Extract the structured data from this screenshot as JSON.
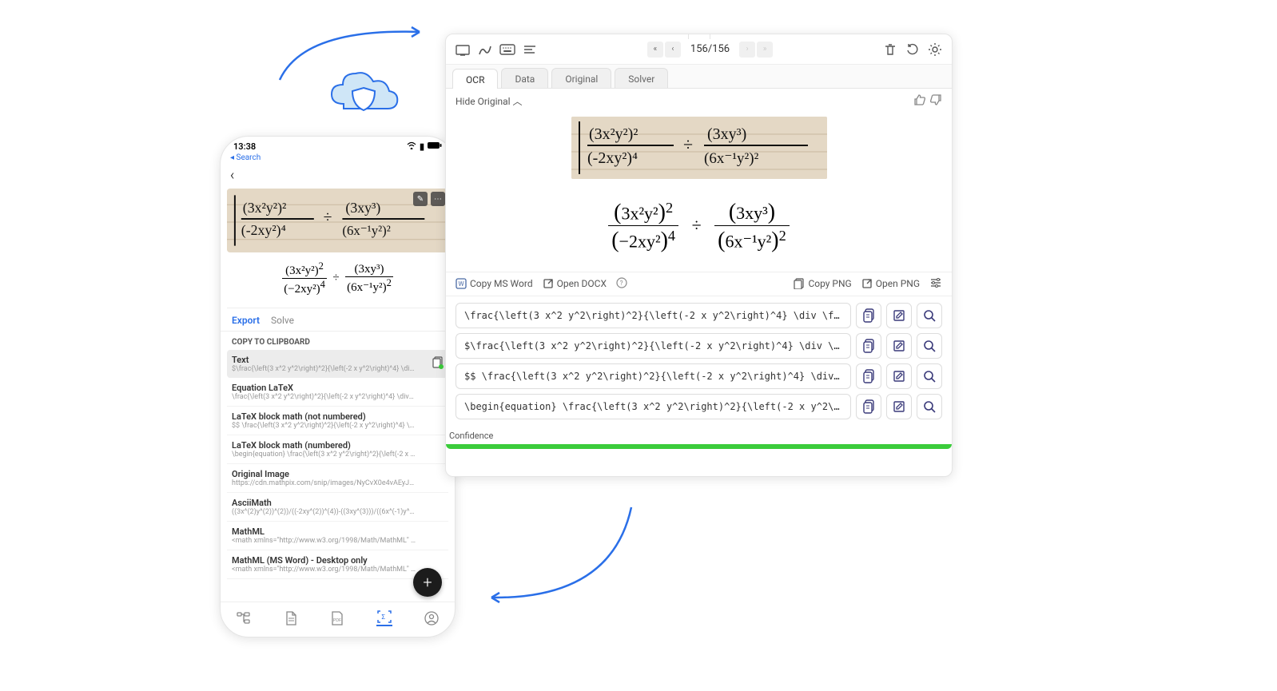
{
  "phone": {
    "status_time": "13:38",
    "search_label": "◂ Search",
    "tabs": {
      "export": "Export",
      "solve": "Solve"
    },
    "copy_header": "COPY TO CLIPBOARD",
    "items": [
      {
        "title": "Text",
        "preview": "$\\frac{\\left(3 x^2 y^2\\right)^2}{\\left(-2 x y^2\\right)^4} \\div \\fra...",
        "selected": true
      },
      {
        "title": "Equation LaTeX",
        "preview": "\\frac{\\left(3 x^2 y^2\\right)^2}{\\left(-2 x y^2\\right)^4} \\div \\frac{\\left(3..."
      },
      {
        "title": "LaTeX block math (not numbered)",
        "preview": "$$ \\frac{\\left(3 x^2 y^2\\right)^2}{\\left(-2 x y^2\\right)^4} \\div \\frac{\\le..."
      },
      {
        "title": "LaTeX block math (numbered)",
        "preview": "\\begin{equation} \\frac{\\left(3 x^2 y^2\\right)^2}{\\left(-2 x y^2\\right)^..."
      },
      {
        "title": "Original Image",
        "preview": "https://cdn.mathpix.com/snip/images/NyCvX0e4vAEyJSJp1B-VuHe..."
      },
      {
        "title": "AsciiMath",
        "preview": "((3x^(2)y^(2))^(2))/((-2xy^(2))^(4))-((3xy^(3)))/((6x^(-1)y^(2))^(2))"
      },
      {
        "title": "MathML",
        "preview": "<math xmlns=\"http://www.w3.org/1998/Math/MathML\" display=\"bl..."
      },
      {
        "title": "MathML (MS Word) - Desktop only",
        "preview": "<math xmlns=\"http://www.w3.org/1998/Math/MathML\" display=..."
      }
    ]
  },
  "panel": {
    "page_counter": "156/156",
    "tabs": [
      "OCR",
      "Data",
      "Original",
      "Solver"
    ],
    "hide_original": "Hide Original",
    "actions": {
      "copy_word": "Copy MS Word",
      "open_docx": "Open DOCX",
      "copy_png": "Copy PNG",
      "open_png": "Open PNG"
    },
    "outputs": [
      "\\frac{\\left(3 x^2 y^2\\right)^2}{\\left(-2 x y^2\\right)^4} \\div \\frac{…",
      "$\\frac{\\left(3 x^2 y^2\\right)^2}{\\left(-2 x y^2\\right)^4} \\div \\frac…",
      "$$ \\frac{\\left(3 x^2 y^2\\right)^2}{\\left(-2 x y^2\\right)^4} \\div \\fr…",
      "\\begin{equation} \\frac{\\left(3 x^2 y^2\\right)^2}{\\left(-2 x y^2\\righ…"
    ],
    "confidence_label": "Confidence"
  },
  "formula": {
    "num1_inner": "3x²y²",
    "num1_exp": "2",
    "den1_inner": "−2xy²",
    "den1_exp": "4",
    "num2_inner": "3xy³",
    "den2_inner": "6x⁻¹y²",
    "den2_exp": "2"
  }
}
